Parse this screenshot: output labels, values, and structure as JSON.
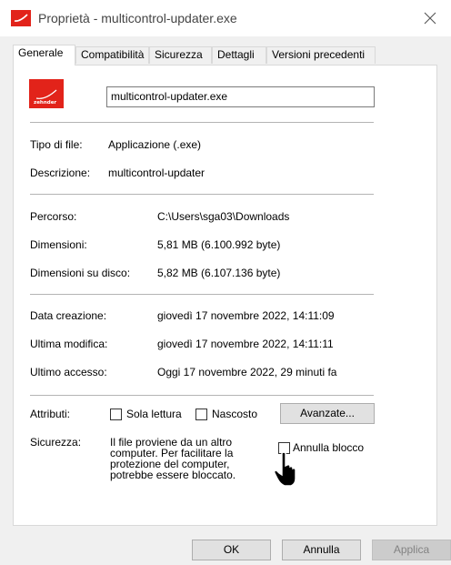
{
  "window": {
    "title": "Proprietà - multicontrol-updater.exe"
  },
  "tabs": [
    "Generale",
    "Compatibilità",
    "Sicurezza",
    "Dettagli",
    "Versioni precedenti"
  ],
  "general": {
    "file_name": "multicontrol-updater.exe",
    "icon_text": "zehnder",
    "rows": {
      "type_label": "Tipo di file:",
      "type_value": "Applicazione (.exe)",
      "desc_label": "Descrizione:",
      "desc_value": "multicontrol-updater",
      "path_label": "Percorso:",
      "path_value": "C:\\Users\\sga03\\Downloads",
      "size_label": "Dimensioni:",
      "size_value": "5,81 MB (6.100.992 byte)",
      "disk_label": "Dimensioni su disco:",
      "disk_value": "5,82 MB (6.107.136 byte)",
      "created_label": "Data creazione:",
      "created_value": "giovedì 17 novembre 2022, 14:11:09",
      "modified_label": "Ultima modifica:",
      "modified_value": "giovedì 17 novembre 2022, 14:11:11",
      "accessed_label": "Ultimo accesso:",
      "accessed_value": "Oggi 17 novembre 2022, 29 minuti fa"
    },
    "attributes": {
      "label": "Attributi:",
      "readonly": {
        "label": "Sola lettura",
        "checked": false
      },
      "hidden": {
        "label": "Nascosto",
        "checked": false
      },
      "advanced": "Avanzate..."
    },
    "security": {
      "label": "Sicurezza:",
      "lines": [
        "Il file proviene da un altro",
        "computer. Per facilitare la",
        "protezione del computer,",
        "potrebbe essere bloccato."
      ],
      "unblock": {
        "label": "Annulla blocco",
        "checked": false
      }
    }
  },
  "buttons": {
    "ok": "OK",
    "cancel": "Annulla",
    "apply": "Applica"
  },
  "colors": {
    "brand": "#e2231a"
  }
}
